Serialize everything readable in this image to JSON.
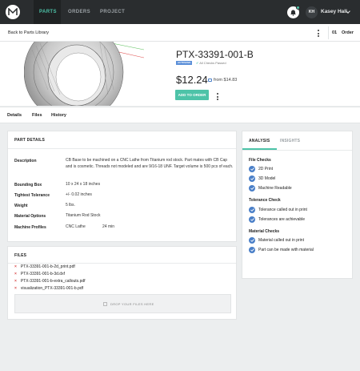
{
  "nav": {
    "tabs": [
      "PARTS",
      "ORDERS",
      "PROJECT"
    ],
    "user_initials": "KH",
    "user_name": "Kasey Hall"
  },
  "subheader": {
    "back_label": "Back to Parts Library",
    "order_count": "01",
    "order_label": "Order"
  },
  "part": {
    "title": "PTX-33391-001-B",
    "badge": "AUTOSAVE",
    "checks_status": "All Checks Passed",
    "price": "$12.24",
    "from_price": "from $14.83",
    "add_button": "ADD TO ORDER"
  },
  "part_tabs": [
    "Details",
    "Files",
    "History"
  ],
  "details": {
    "title": "PART DETAILS",
    "rows": [
      {
        "label": "Description",
        "value": "CB Base to be machined on a CNC Lathe from Titanium rod stock. Part mates with CB Cap and is cosmetic. Threads not modeled and are 9/16-18 UNF. Target volume is 500 pcs of each."
      },
      {
        "label": "Bounding Box",
        "value": "10 x 24 x 18 inches"
      },
      {
        "label": "Tightest Tolerance",
        "value": "+/- 0.02 inches"
      },
      {
        "label": "Weight",
        "value": "5 lbs."
      },
      {
        "label": "Material Options",
        "value": "Titanium Rod Stock"
      },
      {
        "label": "Machine Profiles",
        "value": "CNC Lathe",
        "extra": "24 min"
      }
    ]
  },
  "files": {
    "title": "FILES",
    "items": [
      "PTX-33391-001-b-2d_print.pdf",
      "PTX-33391-001-b-3d.dxf",
      "PTX-33391-001-b-extra_callouts.pdf",
      "visualization_PTX-33391-001-b.pdf"
    ],
    "drop_label": "DROP YOUR FILES HERE"
  },
  "analysis": {
    "tabs": [
      "ANALYSIS",
      "INSIGHTS"
    ],
    "sections": [
      {
        "title": "File Checks",
        "items": [
          "2D Print",
          "3D Model",
          "Machine Readable"
        ]
      },
      {
        "title": "Tolerance Check",
        "items": [
          "Tolerance called out in print",
          "Tolerances are achievable"
        ]
      },
      {
        "title": "Material Checks",
        "items": [
          "Material called out in print",
          "Part can be made with material"
        ]
      }
    ]
  },
  "colors": {
    "accent": "#4dc3a8",
    "nav_bg": "#2a2d2f",
    "check_blue": "#4a7fc8",
    "file_x": "#d94a4a"
  }
}
